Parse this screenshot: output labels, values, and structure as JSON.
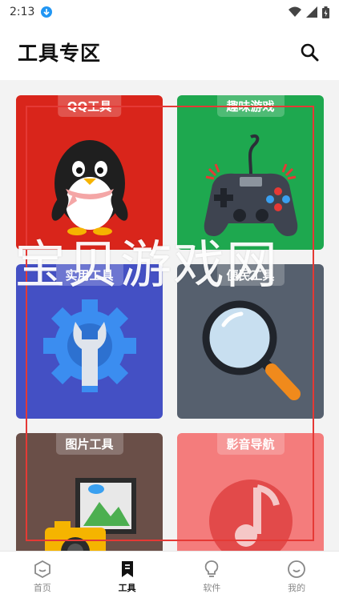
{
  "status_bar": {
    "time": "2:13",
    "icons": [
      "download-icon",
      "wifi-icon",
      "signal-icon",
      "battery-icon"
    ]
  },
  "header": {
    "title": "工具专区",
    "search_icon": "search-icon"
  },
  "cards": [
    {
      "label": "QQ工具",
      "color": "#d9251b",
      "icon": "penguin-icon"
    },
    {
      "label": "趣味游戏",
      "color": "#1ea84f",
      "icon": "gamepad-icon"
    },
    {
      "label": "实用工具",
      "color": "#4450c4",
      "icon": "wrench-gear-icon"
    },
    {
      "label": "便民工具",
      "color": "#56606e",
      "icon": "magnifier-icon"
    },
    {
      "label": "图片工具",
      "color": "#6a4f48",
      "icon": "photo-camera-icon"
    },
    {
      "label": "影音导航",
      "color": "#f47c7c",
      "icon": "music-note-icon"
    }
  ],
  "watermark": "宝贝游戏网",
  "tabs": [
    {
      "label": "首页",
      "icon": "home-icon",
      "active": false
    },
    {
      "label": "工具",
      "icon": "bookmark-icon",
      "active": true
    },
    {
      "label": "软件",
      "icon": "bulb-icon",
      "active": false
    },
    {
      "label": "我的",
      "icon": "smile-icon",
      "active": false
    }
  ]
}
